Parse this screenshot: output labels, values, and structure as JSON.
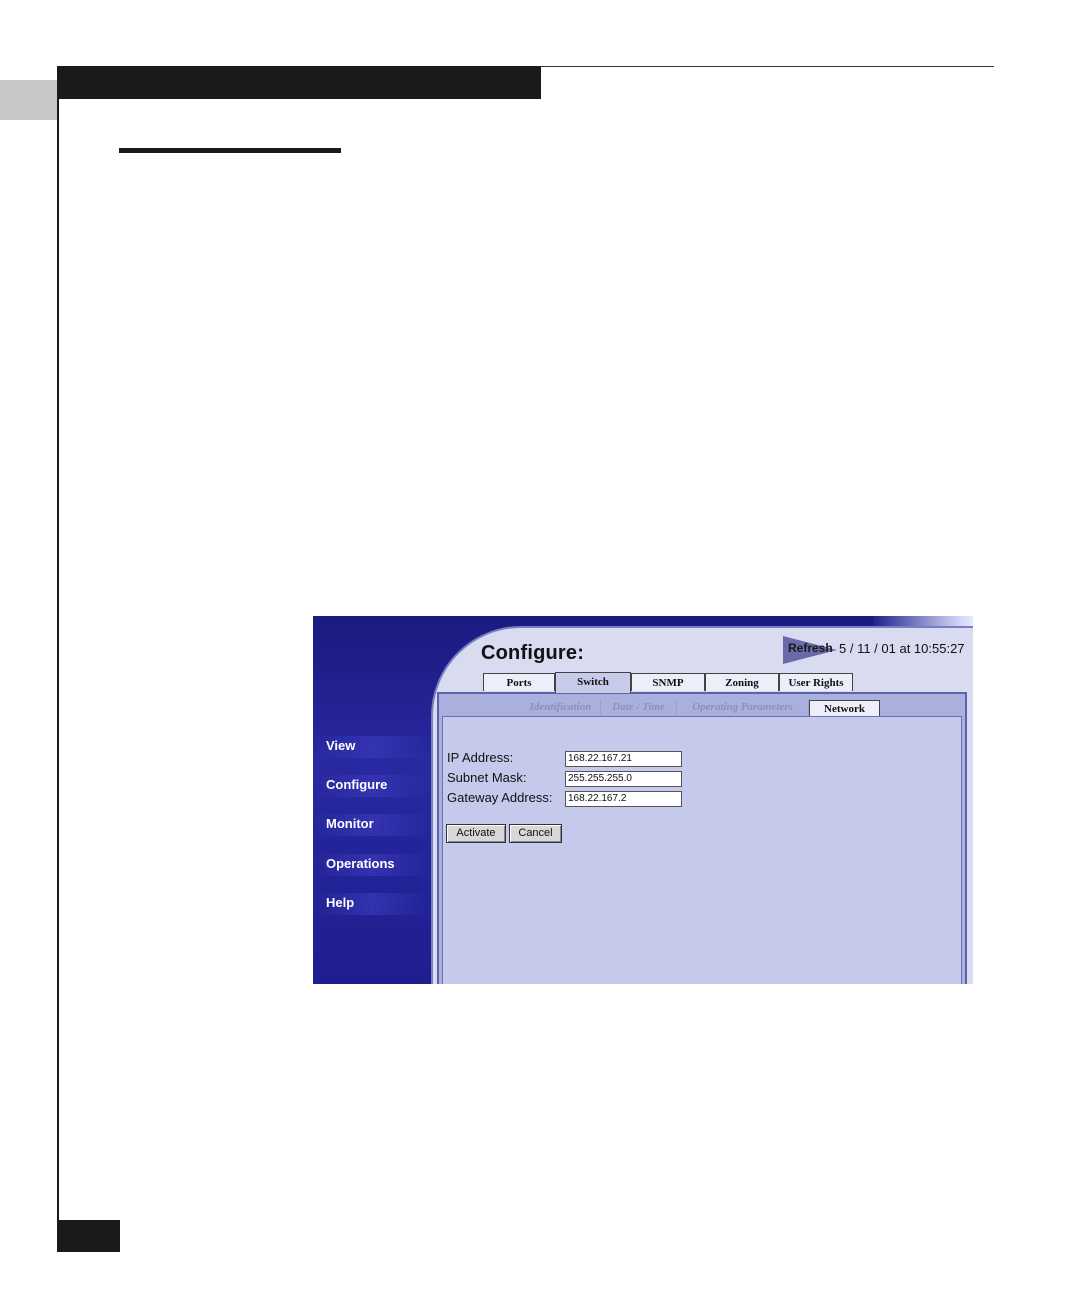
{
  "app": {
    "title": "Configure:",
    "refresh_label": "Refresh",
    "timestamp": "5 / 11 / 01 at 10:55:27"
  },
  "nav": {
    "items": [
      {
        "label": "View"
      },
      {
        "label": "Configure"
      },
      {
        "label": "Monitor"
      },
      {
        "label": "Operations"
      },
      {
        "label": "Help"
      }
    ]
  },
  "tabs": [
    {
      "label": "Ports",
      "active": false
    },
    {
      "label": "Switch",
      "active": true
    },
    {
      "label": "SNMP",
      "active": false
    },
    {
      "label": "Zoning",
      "active": false
    },
    {
      "label": "User Rights",
      "active": false
    }
  ],
  "subtabs": [
    {
      "label": "Identification",
      "active": false
    },
    {
      "label": "Date / Time",
      "active": false
    },
    {
      "label": "Operating Parameters",
      "active": false
    },
    {
      "label": "Network",
      "active": true
    }
  ],
  "form": {
    "ip_label": "IP  Address:",
    "ip_value": "168.22.167.21",
    "subnet_label": "Subnet Mask:",
    "subnet_value": "255.255.255.0",
    "gateway_label": "Gateway Address:",
    "gateway_value": "168.22.167.2"
  },
  "buttons": {
    "activate": "Activate",
    "cancel": "Cancel"
  },
  "colors": {
    "nav_background": "#20208c",
    "panel": "#c5caed"
  }
}
